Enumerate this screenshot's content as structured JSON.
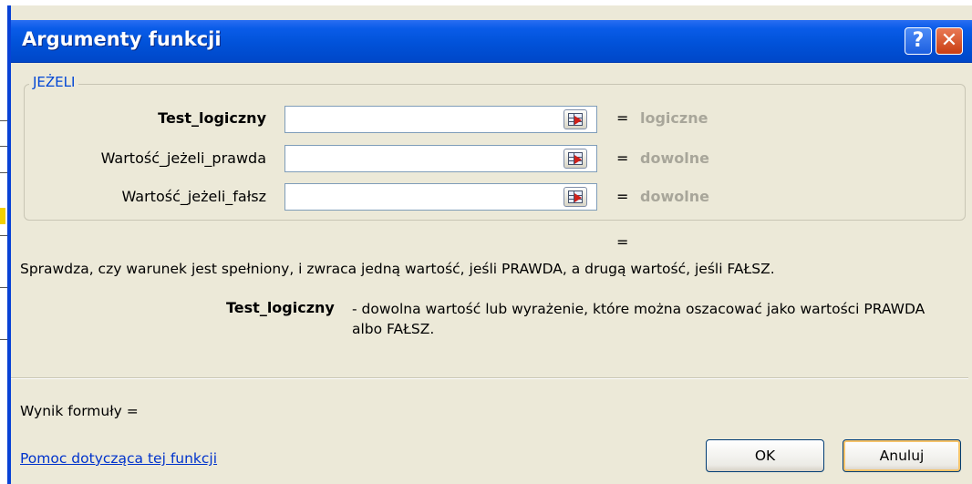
{
  "window": {
    "title": "Argumenty funkcji",
    "help_button": "?",
    "close_button": "✕"
  },
  "function_group": {
    "name": "JEŻELI",
    "arguments": [
      {
        "label": "Test_logiczny",
        "value": "",
        "result_type": "logiczne",
        "equals": "="
      },
      {
        "label": "Wartość_jeżeli_prawda",
        "value": "",
        "result_type": "dowolne",
        "equals": "="
      },
      {
        "label": "Wartość_jeżeli_fałsz",
        "value": "",
        "result_type": "dowolne",
        "equals": "="
      }
    ],
    "ref_button_icon": "collapse-dialog-icon"
  },
  "function_result_equals": "=",
  "description": "Sprawdza, czy warunek jest spełniony, i zwraca jedną wartość, jeśli PRAWDA, a drugą wartość, jeśli FAŁSZ.",
  "argument_help": {
    "name": "Test_logiczny",
    "text": "- dowolna wartość lub wyrażenie, które można oszacować jako wartości PRAWDA albo FAŁSZ."
  },
  "formula_result_label": "Wynik formuły =",
  "help_link": "Pomoc dotycząca tej funkcji",
  "buttons": {
    "ok": "OK",
    "cancel": "Anuluj"
  },
  "colors": {
    "titlebar": "#0152d9",
    "dialog_bg": "#ece9d8",
    "group_label": "#0046d5",
    "result_type": "#a8a69a",
    "link": "#0033cc"
  }
}
